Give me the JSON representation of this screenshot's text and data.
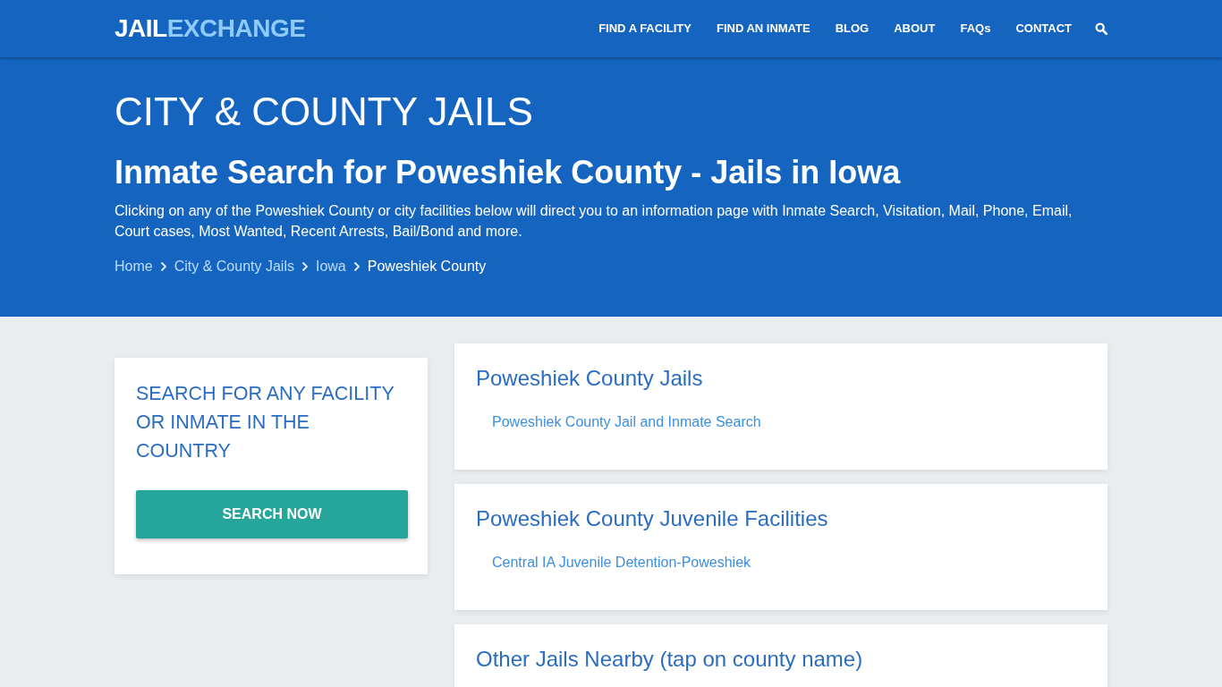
{
  "navbar": {
    "logo": {
      "text": "JAIL",
      "accent": "EXCHANGE"
    },
    "menu": [
      {
        "label": "FIND A FACILITY"
      },
      {
        "label": "FIND AN INMATE"
      },
      {
        "label": "BLOG"
      },
      {
        "label": "ABOUT"
      },
      {
        "label": "FAQs"
      },
      {
        "label": "CONTACT"
      }
    ]
  },
  "hero": {
    "title": "CITY & COUNTY JAILS",
    "subtitle": "Inmate Search for Poweshiek County - Jails in Iowa",
    "description": "Clicking on any of the Poweshiek County or city facilities below will direct you to an information page with Inmate Search, Visitation, Mail, Phone, Email, Court cases, Most Wanted, Recent Arrests, Bail/Bond and more.",
    "breadcrumb": [
      {
        "label": "Home",
        "current": false
      },
      {
        "label": "City & County Jails",
        "current": false
      },
      {
        "label": "Iowa",
        "current": false
      },
      {
        "label": "Poweshiek County",
        "current": true
      }
    ]
  },
  "sidebar": {
    "heading": "SEARCH FOR ANY FACILITY OR INMATE IN THE COUNTRY",
    "button": "SEARCH NOW"
  },
  "sections": [
    {
      "title": "Poweshiek County Jails",
      "links": [
        "Poweshiek County Jail and Inmate Search"
      ]
    },
    {
      "title": "Poweshiek County Juvenile Facilities",
      "links": [
        "Central IA Juvenile Detention-Poweshiek"
      ]
    },
    {
      "title": "Other Jails Nearby (tap on county name)"
    }
  ]
}
